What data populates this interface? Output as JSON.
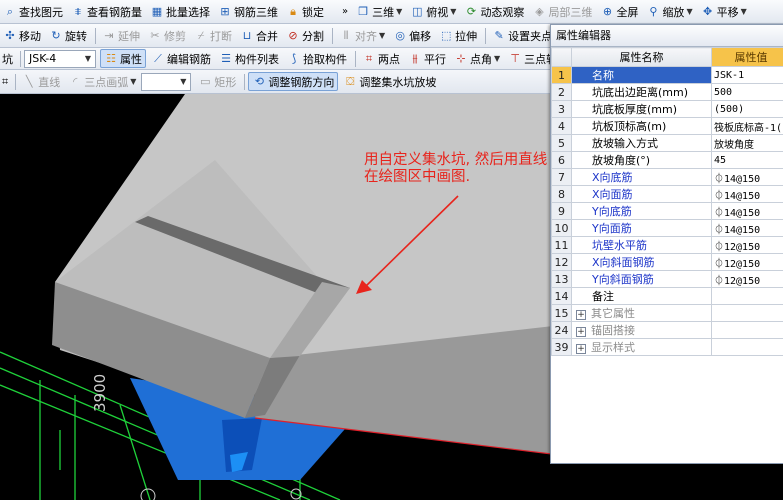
{
  "toolbar1": {
    "items": [
      {
        "label": "查找图元",
        "icon": "find-icon"
      },
      {
        "label": "查看钢筋量",
        "icon": "rebar-view-icon"
      },
      {
        "label": "批量选择",
        "icon": "batch-select-icon"
      },
      {
        "label": "钢筋三维",
        "icon": "rebar-3d-icon"
      },
      {
        "label": "锁定",
        "icon": "lock-icon"
      },
      {
        "label": "三维",
        "icon": "cube-3d-icon"
      },
      {
        "label": "俯视",
        "icon": "top-view-icon"
      },
      {
        "label": "动态观察",
        "icon": "orbit-icon"
      },
      {
        "label": "局部三维",
        "icon": "local-3d-icon"
      },
      {
        "label": "全屏",
        "icon": "fullscreen-icon"
      },
      {
        "label": "缩放",
        "icon": "zoom-icon"
      },
      {
        "label": "平移",
        "icon": "pan-icon"
      }
    ]
  },
  "toolbar2": {
    "move": "移动",
    "rotate": "旋转",
    "extend": "延伸",
    "trim": "修剪",
    "break": "打断",
    "merge": "合并",
    "split": "分割",
    "align": "对齐",
    "offset": "偏移",
    "stretch": "拉伸",
    "set_point": "设置夹点"
  },
  "toolbar3": {
    "element_combo": "JSK-4",
    "properties": "属性",
    "edit_rebar": "编辑钢筋",
    "component_list": "构件列表",
    "pick_component": "拾取构件",
    "two_points": "两点",
    "parallel": "平行",
    "point_angle": "点角",
    "three_point": "三点辅"
  },
  "toolbar4": {
    "line": "直线",
    "three_point_arc": "三点画弧",
    "rect": "矩形",
    "adjust_rebar_dir": "调整钢筋方向",
    "adjust_pit_slope": "调整集水坑放坡"
  },
  "annotation": {
    "line1": "用自定义集水坑, 然后用直线",
    "line2": "在绘图区中画图."
  },
  "dimension": "3900",
  "properties_panel": {
    "title": "属性编辑器",
    "header_name": "属性名称",
    "header_value": "属性值",
    "rows": [
      {
        "no": "1",
        "name": "名称",
        "value": "JSK-1",
        "style": "sel"
      },
      {
        "no": "2",
        "name": "坑底出边距离(mm)",
        "value": "500",
        "style": ""
      },
      {
        "no": "3",
        "name": "坑底板厚度(mm)",
        "value": "(500)",
        "style": ""
      },
      {
        "no": "4",
        "name": "坑板顶标高(m)",
        "value": "筏板底标高-1(",
        "style": ""
      },
      {
        "no": "5",
        "name": "放坡输入方式",
        "value": "放坡角度",
        "style": ""
      },
      {
        "no": "6",
        "name": "放坡角度(°)",
        "value": "45",
        "style": ""
      },
      {
        "no": "7",
        "name": "X向底筋",
        "value": "⏀14@150",
        "style": "blue"
      },
      {
        "no": "8",
        "name": "X向面筋",
        "value": "⏀14@150",
        "style": "blue"
      },
      {
        "no": "9",
        "name": "Y向底筋",
        "value": "⏀14@150",
        "style": "blue"
      },
      {
        "no": "10",
        "name": "Y向面筋",
        "value": "⏀14@150",
        "style": "blue"
      },
      {
        "no": "11",
        "name": "坑壁水平筋",
        "value": "⏀12@150",
        "style": "blue"
      },
      {
        "no": "12",
        "name": "X向斜面钢筋",
        "value": "⏀12@150",
        "style": "blue"
      },
      {
        "no": "13",
        "name": "Y向斜面钢筋",
        "value": "⏀12@150",
        "style": "blue"
      },
      {
        "no": "14",
        "name": "备注",
        "value": "",
        "style": ""
      },
      {
        "no": "15",
        "name": "其它属性",
        "value": "",
        "style": "group"
      },
      {
        "no": "24",
        "name": "锚固搭接",
        "value": "",
        "style": "group"
      },
      {
        "no": "39",
        "name": "显示样式",
        "value": "",
        "style": "group"
      }
    ]
  },
  "colors": {
    "slab_top": "#c6c6c6",
    "slab_side": "#9a9a9a",
    "pit_blue": "#1f6fd6",
    "grid_green": "#1fd13a",
    "annotation_red": "#e8241c",
    "selected_blue": "#2f62c4",
    "header_orange": "#f6c34a"
  }
}
